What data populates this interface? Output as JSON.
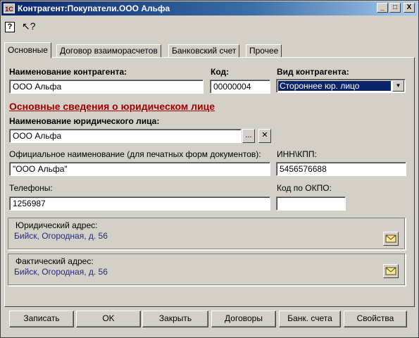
{
  "window": {
    "title": "Контрагент:Покупатели.ООО Альфа",
    "app_icon": "1C",
    "minimize_glyph": "_",
    "maximize_glyph": "□",
    "close_glyph": "X"
  },
  "toolbar": {
    "help_icon": "question-icon",
    "help_glyph": "?",
    "whatsthis_icon": "pointer-question-icon",
    "whatsthis_glyph": "↖?"
  },
  "tabs": [
    {
      "label": "Основные",
      "active": true
    },
    {
      "label": "Договор взаиморасчетов",
      "active": false
    },
    {
      "label": "Банковский счет",
      "active": false
    },
    {
      "label": "Прочее",
      "active": false
    }
  ],
  "form": {
    "name_label": "Наименование контрагента:",
    "name_value": "ООО Альфа",
    "code_label": "Код:",
    "code_value": "00000004",
    "type_label": "Вид контрагента:",
    "type_value": "Стороннее юр. лицо",
    "section_title": "Основные сведения о юридическом лице",
    "legal_name_label": "Наименование юридического лица:",
    "legal_name_value": "ООО Альфа",
    "select_glyph": "...",
    "clear_glyph": "✕",
    "official_name_label": "Официальное наименование (для печатных форм документов):",
    "official_name_value": "\"ООО Альфа\"",
    "inn_label": "ИНН\\КПП:",
    "inn_value": "5456576688",
    "phones_label": "Телефоны:",
    "phones_value": "1256987",
    "okpo_label": "Код по ОКПО:",
    "okpo_value": "",
    "legal_address_label": "Юридический адрес:",
    "legal_address_value": "Бийск, Огородная, д. 56",
    "actual_address_label": "Фактический адрес:",
    "actual_address_value": "Бийск, Огородная, д. 56"
  },
  "buttons": {
    "save": "Записать",
    "ok": "OK",
    "close": "Закрыть",
    "contracts": "Договоры",
    "bank_accounts": "Банк. счета",
    "properties": "Свойства"
  },
  "colors": {
    "section_title": "#a00000",
    "address_text": "#1f2a80",
    "title_bar": "#0a246a"
  }
}
